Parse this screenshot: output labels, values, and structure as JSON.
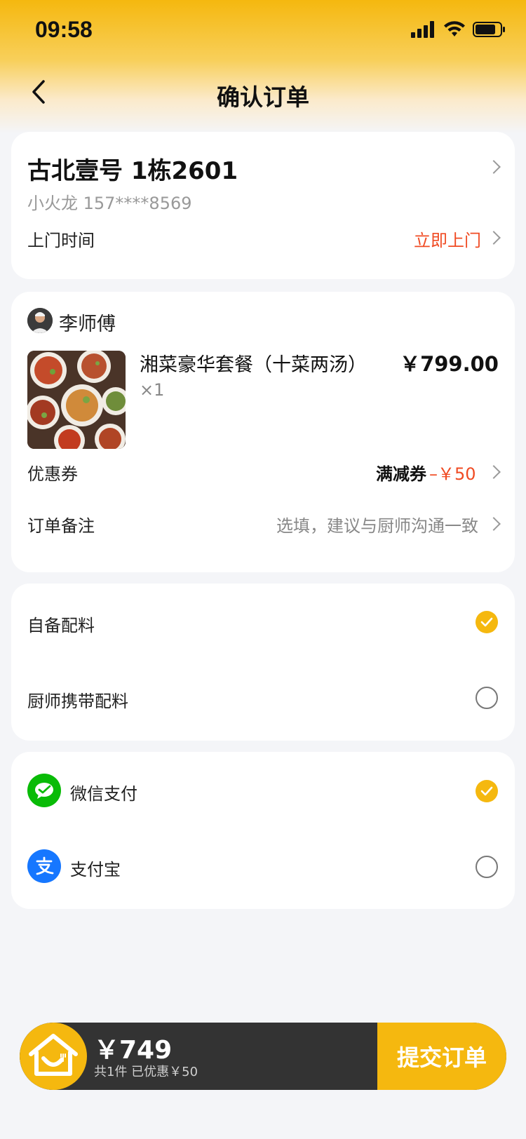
{
  "status_bar": {
    "time": "09:58"
  },
  "nav": {
    "title": "确认订单"
  },
  "address": {
    "line": "古北壹号 1栋2601",
    "contact": "小火龙 157****8569",
    "visit_time_label": "上门时间",
    "visit_time_value": "立即上门"
  },
  "order": {
    "chef_name": "李师傅",
    "dish_name": "湘菜豪华套餐（十菜两汤）",
    "dish_price": "￥799.00",
    "dish_qty": "×1",
    "coupon_label": "优惠券",
    "coupon_type": "满减券",
    "coupon_value": "–￥50",
    "remark_label": "订单备注",
    "remark_placeholder": "选填，建议与厨师沟通一致"
  },
  "ingredients": {
    "options": [
      {
        "label": "自备配料",
        "selected": true
      },
      {
        "label": "厨师携带配料",
        "selected": false
      }
    ]
  },
  "payment": {
    "options": [
      {
        "label": "微信支付",
        "icon": "wechat-pay-icon",
        "color": "#09bb07",
        "selected": true
      },
      {
        "label": "支付宝",
        "icon": "alipay-icon",
        "color": "#1677ff",
        "selected": false
      }
    ]
  },
  "bottom": {
    "total": "￥749",
    "summary": "共1件 已优惠￥50",
    "submit_label": "提交订单"
  },
  "colors": {
    "accent": "#f5b80f",
    "price_red": "#f04b23",
    "dark_bar": "#333333"
  }
}
